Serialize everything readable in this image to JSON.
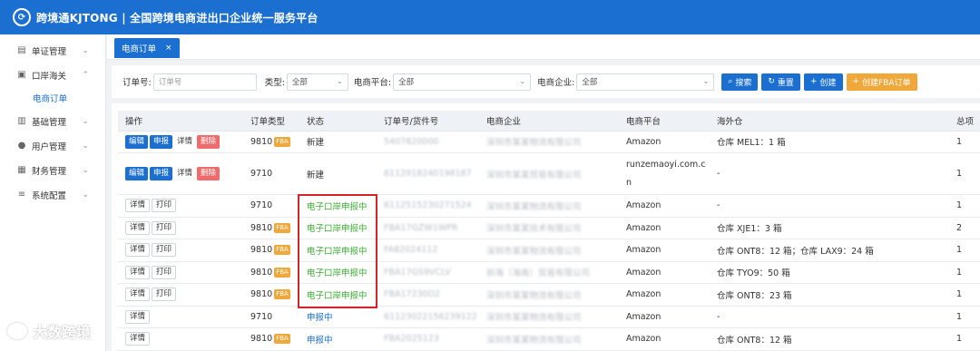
{
  "app": {
    "title": "跨境通KJTONG | 全国跨境电商进出口企业统一服务平台"
  },
  "sidebar": {
    "items": [
      {
        "label": "单证管理",
        "icon": "document-icon",
        "chevron": "⌄"
      },
      {
        "label": "口岸海关",
        "icon": "clipboard-icon",
        "chevron": "⌃"
      },
      {
        "label": "基础管理",
        "icon": "chart-icon",
        "chevron": "⌄"
      },
      {
        "label": "用户管理",
        "icon": "user-icon",
        "chevron": "⌄"
      },
      {
        "label": "财务管理",
        "icon": "finance-icon",
        "chevron": "⌄"
      },
      {
        "label": "系统配置",
        "icon": "menu-icon",
        "chevron": "⌄"
      }
    ],
    "sub_item": "电商订单"
  },
  "tabs": [
    {
      "label": "电商订单",
      "close": "×"
    }
  ],
  "filter": {
    "order_no_label": "订单号:",
    "order_no_placeholder": "订单号",
    "type_label": "类型:",
    "type_value": "全部",
    "platform_label": "电商平台:",
    "platform_value": "全部",
    "company_label": "电商企业:",
    "company_value": "全部",
    "search_label": "搜索",
    "reset_label": "重置",
    "create_label": "创建",
    "create_fba_label": "创建FBA订单"
  },
  "table": {
    "headers": [
      "操作",
      "订单类型",
      "状态",
      "订单号/货件号",
      "电商企业",
      "电商平台",
      "海外仓",
      "总项"
    ],
    "op_labels": {
      "edit": "编辑",
      "report": "申报",
      "detail": "详情",
      "delete": "删除",
      "print": "打印"
    },
    "fba_badge": "FBA",
    "rows": [
      {
        "ops": "edit",
        "type": "9810",
        "fba": true,
        "status": "新建",
        "status_color": "normal",
        "order_no": "5407820000",
        "company": "深圳市某某物流有限公司",
        "platform": "Amazon",
        "warehouse": "仓库 MEL1：1 箱",
        "total": "1"
      },
      {
        "ops": "edit",
        "type": "9710",
        "fba": false,
        "status": "新建",
        "status_color": "normal",
        "order_no": "6112918240198187",
        "company": "深圳市某某贸易有限公司",
        "platform": "runzemaoyi.com.cn",
        "warehouse": "-",
        "total": "1",
        "tall": true
      },
      {
        "ops": "print",
        "type": "9710",
        "fba": false,
        "status": "电子口岸申报中",
        "status_color": "green",
        "order_no": "6112515230271524",
        "company": "深圳市某某物流有限公司",
        "platform": "Amazon",
        "warehouse": "-",
        "total": "1"
      },
      {
        "ops": "print",
        "type": "9810",
        "fba": true,
        "status": "电子口岸申报中",
        "status_color": "green",
        "order_no": "FBA17GZW1WPR",
        "company": "深圳市某某技术有限公司",
        "platform": "Amazon",
        "warehouse": "仓库 XJE1：3 箱",
        "total": "2"
      },
      {
        "ops": "print",
        "type": "9810",
        "fba": true,
        "status": "电子口岸申报中",
        "status_color": "green",
        "order_no": "FA82024112",
        "company": "深圳市某某物流有限公司",
        "platform": "Amazon",
        "warehouse": "仓库 ONT8：12 箱；仓库 LAX9：24 箱",
        "total": "1"
      },
      {
        "ops": "print",
        "type": "9810",
        "fba": true,
        "status": "电子口岸申报中",
        "status_color": "green",
        "order_no": "FBA17GS9VCLV",
        "company": "前海（海南）贸易有限公司",
        "platform": "Amazon",
        "warehouse": "仓库 TYO9：50 箱",
        "total": "1"
      },
      {
        "ops": "print",
        "type": "9810",
        "fba": true,
        "status": "电子口岸申报中",
        "status_color": "green",
        "order_no": "FBA17230D2",
        "company": "深圳市某某物流有限公司",
        "platform": "Amazon",
        "warehouse": "仓库 ONT8：23 箱",
        "total": "1"
      },
      {
        "ops": "detail",
        "type": "9710",
        "fba": false,
        "status": "申报中",
        "status_color": "blue",
        "order_no": "61123022156239122",
        "company": "深圳市某某物流有限公司",
        "platform": "Amazon",
        "warehouse": "-",
        "total": "1"
      },
      {
        "ops": "detail",
        "type": "9810",
        "fba": true,
        "status": "申报中",
        "status_color": "blue",
        "order_no": "FBA2025123",
        "company": "深圳市某某物流有限公司",
        "platform": "Amazon",
        "warehouse": "仓库 ONT8：12 箱",
        "total": "1"
      }
    ]
  },
  "watermark": "大数跨境",
  "colors": {
    "brand": "#1b6fd0",
    "accent_orange": "#f0a83a",
    "delete": "#f06b6b",
    "status_green": "#3cb034",
    "highlight_border": "#d4242a"
  }
}
